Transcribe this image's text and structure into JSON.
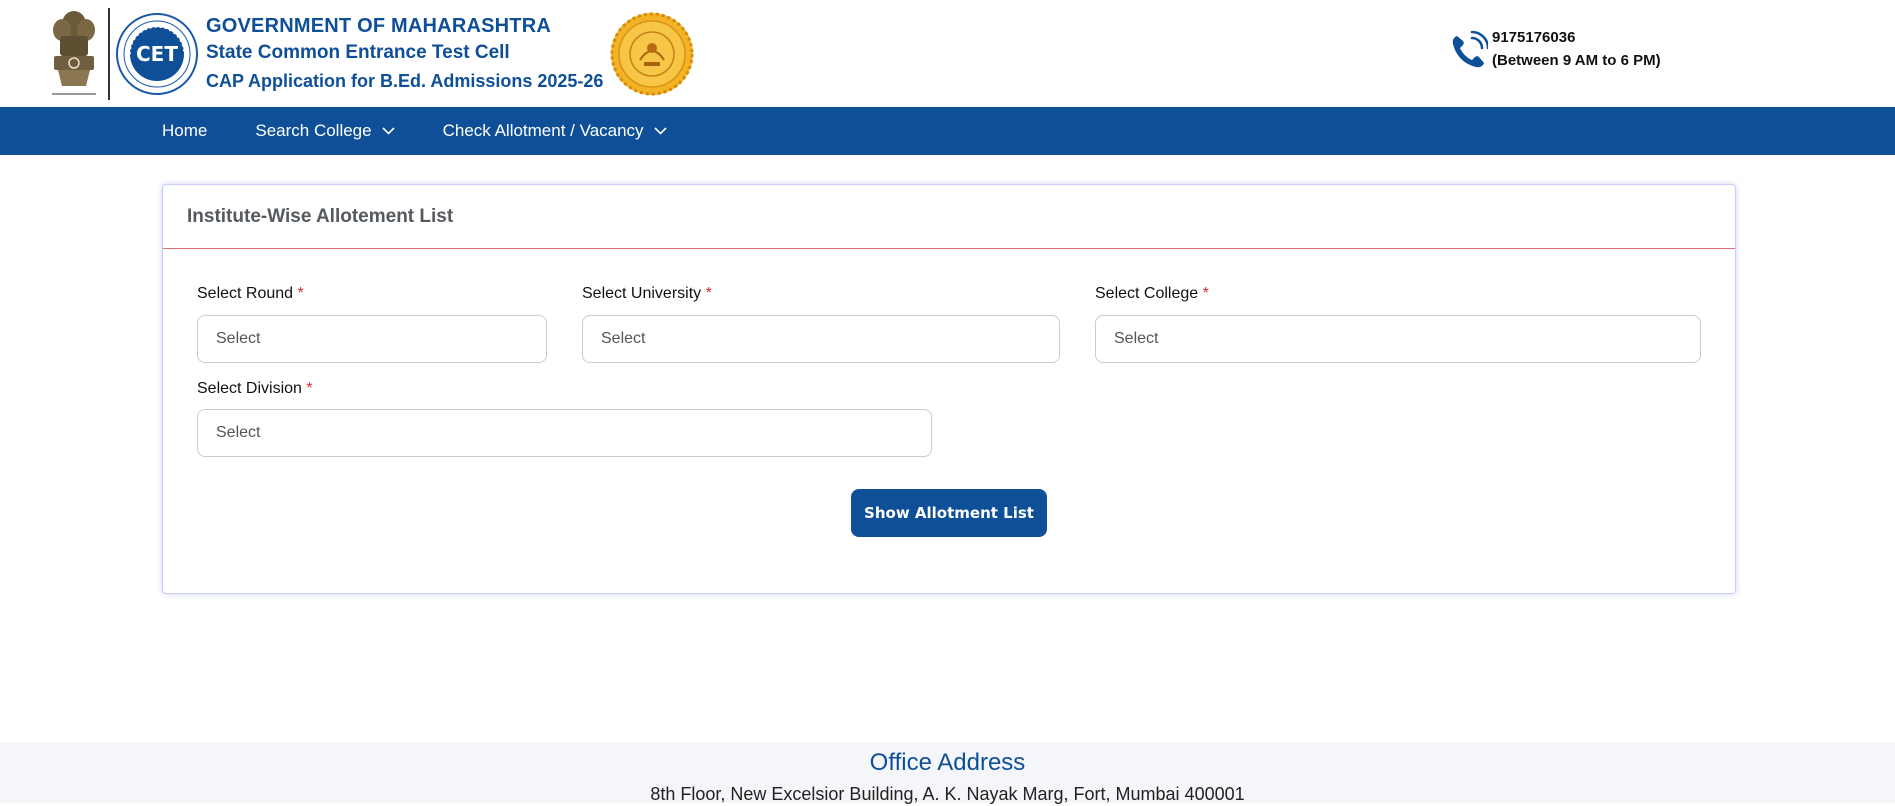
{
  "header": {
    "org_title": "GOVERNMENT OF MAHARASHTRA",
    "cell_title": "State Common Entrance Test Cell",
    "app_title": "CAP Application for B.Ed. Admissions 2025-26",
    "logo_text": "CET",
    "phone": "9175176036",
    "phone_hours": "(Between 9 AM to 6 PM)"
  },
  "nav": {
    "home": "Home",
    "search_college": "Search College",
    "check_allotment": "Check Allotment / Vacancy"
  },
  "card": {
    "title": "Institute-Wise Allotement List",
    "fields": {
      "round_label": "Select Round",
      "round_value": "Select",
      "university_label": "Select University",
      "university_value": "Select",
      "college_label": "Select College",
      "college_value": "Select",
      "division_label": "Select Division",
      "division_value": "Select"
    },
    "required_mark": "*",
    "button_label": "Show Allotment List"
  },
  "footer": {
    "title": "Office Address",
    "address": "8th Floor, New Excelsior Building, A. K. Nayak Marg, Fort, Mumbai 400001"
  },
  "colors": {
    "brand_blue": "#0f4f98",
    "required_red": "#d42b2b",
    "card_divider": "#e06b7a"
  },
  "icons": {
    "emblem": "national-emblem-icon",
    "cet_logo": "cet-logo-icon",
    "seal": "maharashtra-seal-icon",
    "phone": "phone-icon",
    "chevron": "chevron-down-icon"
  }
}
